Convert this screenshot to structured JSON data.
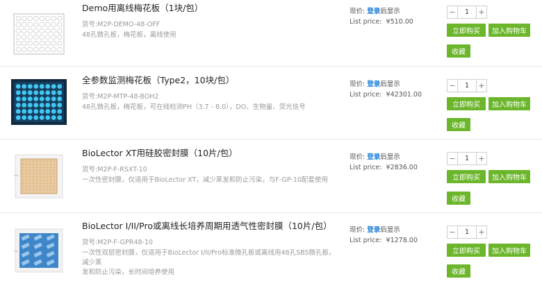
{
  "labels": {
    "price_prefix": "现价:",
    "login": "登录",
    "after_login": "后显示",
    "list_price_prefix": "List price:",
    "buy_now": "立即购买",
    "add_to_cart": "加入购物车",
    "favorite": "收藏",
    "minus": "−",
    "plus": "+"
  },
  "products": [
    {
      "title": "Demo用离线梅花板（1块/包）",
      "sku": "货号:M2P-DEMO-48-OFF",
      "desc": "48孔微孔板，梅花板，离线使用",
      "desc2": "",
      "list_price": "¥510.00",
      "qty": "1",
      "thumb": "plate-outline"
    },
    {
      "title": "全参数监测梅花板（Type2，10块/包）",
      "sku": "货号:M2P-MTP-48-BOH2",
      "desc": "48孔微孔板，梅花板，可在线检测PH（3.7 - 8.0），DO、生物量、荧光信号",
      "desc2": "",
      "list_price": "¥42301.00",
      "qty": "1",
      "thumb": "plate-blue"
    },
    {
      "title": "BioLector XT用硅胶密封膜（10片/包）",
      "sku": "货号:M2P-F-RSXT-10",
      "desc": "一次性密封膜，仅适用于BioLector XT，减少蒸发和防止污染，与F-GP-10配套使用",
      "desc2": "",
      "list_price": "¥2836.00",
      "qty": "1",
      "thumb": "silicone-seal"
    },
    {
      "title": "BioLector I/II/Pro或离线长培养周期用透气性密封膜（10片/包）",
      "sku": "货号:M2P-F-GPR48-10",
      "desc": "一次性双层密封膜，仅适用于BioLector I/II/Pro标准微孔板或离线用48孔SBS微孔板，减少蒸",
      "desc2": "发和防止污染，长时间培养使用",
      "list_price": "¥1278.00",
      "qty": "1",
      "thumb": "gas-permeable-seal"
    }
  ]
}
